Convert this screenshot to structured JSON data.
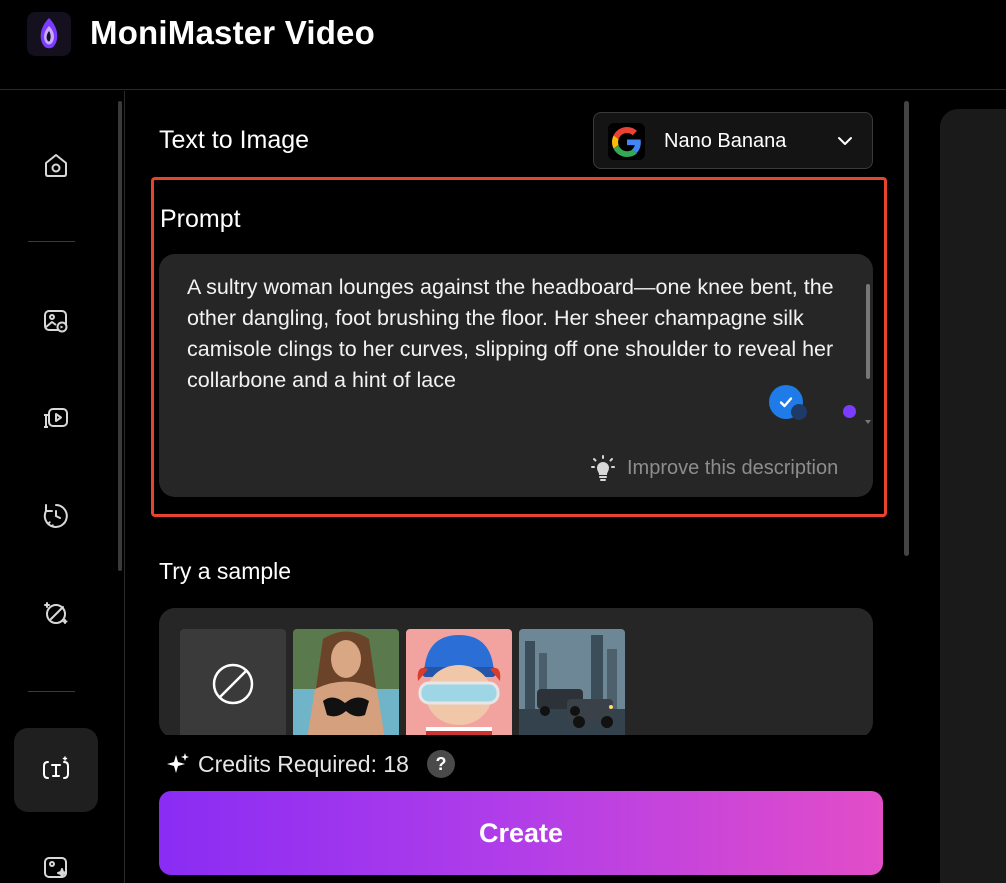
{
  "app": {
    "title": "MoniMaster Video"
  },
  "panel": {
    "section_title": "Text to Image",
    "model": {
      "name": "Nano Banana",
      "icon": "google-g-icon"
    },
    "prompt": {
      "label": "Prompt",
      "value": "A sultry woman lounges against the headboard—one knee bent, the other dangling, foot brushing the floor. Her sheer champagne silk camisole clings to her curves, slipping off one shoulder to reveal her collarbone and a hint of lace",
      "improve_label": "Improve this description"
    },
    "samples": {
      "title": "Try a sample",
      "items": [
        {
          "name": "none",
          "icon": "no-sample-icon"
        },
        {
          "name": "woman-photo"
        },
        {
          "name": "cartoon-boy-goggles"
        },
        {
          "name": "sci-fi-vehicles"
        }
      ]
    },
    "credits": {
      "label": "Credits Required: 18",
      "help": "?"
    },
    "create_label": "Create"
  },
  "sidebar": {
    "items": [
      {
        "name": "home",
        "icon": "home-icon"
      },
      {
        "name": "image-edit",
        "icon": "image-edit-icon"
      },
      {
        "name": "text-to-video",
        "icon": "text-to-video-icon"
      },
      {
        "name": "history",
        "icon": "refresh-timer-icon"
      },
      {
        "name": "magic-tools",
        "icon": "magic-pen-icon"
      },
      {
        "name": "text-to-image",
        "icon": "text-image-icon",
        "active": true
      },
      {
        "name": "image-enhance",
        "icon": "image-sparkle-icon"
      }
    ]
  },
  "colors": {
    "highlight": "#e8432e",
    "accent_start": "#8a2cf4",
    "accent_end": "#e24dc8",
    "panel_bg": "#262626"
  }
}
